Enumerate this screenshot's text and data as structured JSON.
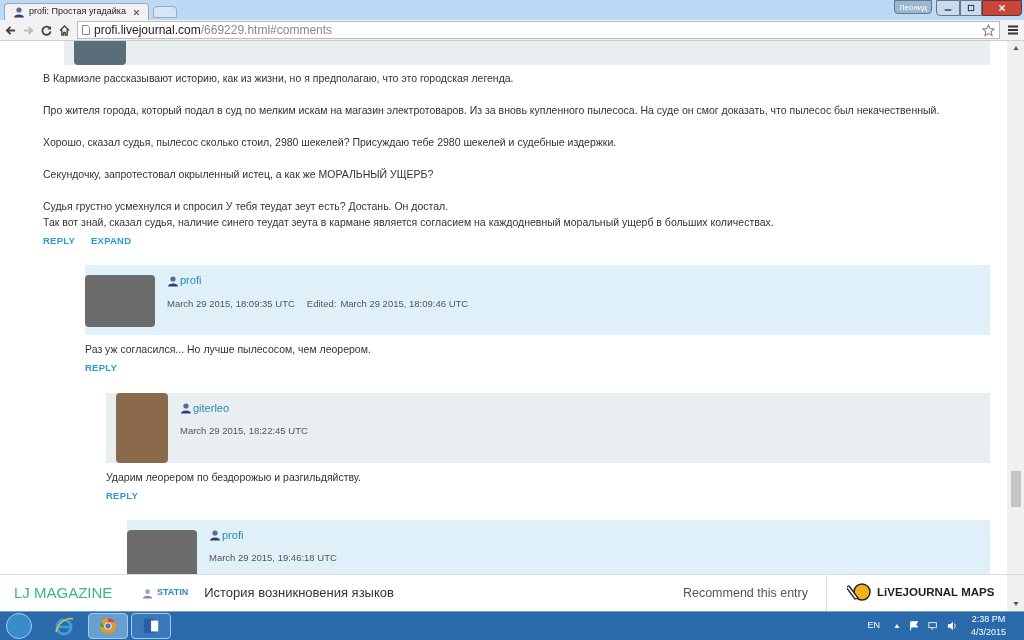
{
  "browser": {
    "tab_title": "profi: Простая угадайка",
    "user_button": "Леонид",
    "url_host": "profi.livejournal.com",
    "url_path": "/669229.html#comments"
  },
  "comments": [
    {
      "paragraphs": [
        "В Кармиэле рассказывают историю, как из жизни, но я предполагаю, что это городская легенда.",
        "Про жителя города, который подал в суд по мелким искам на магазин электротоваров. Из за вновь купленного пылесоса. На суде он смог доказать, что пылесос был некачественный.",
        "Хорошо, сказал судья, пылесос сколько стоил, 2980 шекелей? Присуждаю тебе 2980 шекелей и судебные издержки.",
        "Секундочку, запротестовал окрыленный истец, а как же МОРАЛЬНЫЙ УЩЕРБ?",
        "Судья грустно усмехнулся и спросил У тебя теудат зеут есть? Достань. Он достал.\nТак вот знай, сказал судья, наличие синего теудат зеута в кармане является согласием на каждодневный моральный ущерб в больших количествах."
      ],
      "actions": [
        "REPLY",
        "EXPAND"
      ],
      "children": [
        {
          "author": "profi",
          "date": "March 29 2015, 18:09:35 UTC",
          "edited_label": "Edited:",
          "edited_date": "March 29 2015, 18:09:46 UTC",
          "paragraphs": [
            "Раз уж согласился... Но лучше пылесосом, чем леорером."
          ],
          "actions": [
            "REPLY"
          ],
          "children": [
            {
              "author": "giterleo",
              "date": "March 29 2015, 18:22:45 UTC",
              "paragraphs": [
                "Ударим леорером по бездорожью и разгильдяйству."
              ],
              "actions": [
                "REPLY"
              ],
              "children": [
                {
                  "author": "profi",
                  "date": "March 29 2015, 19:46:18 UTC"
                }
              ]
            }
          ]
        }
      ]
    }
  ],
  "bottom_bar": {
    "section": "LJ MAGAZINE",
    "user": "STATIN",
    "headline": "История возникновения языков",
    "recommend": "Recommend this entry",
    "logo": "LiVEJOURNAL MAPS"
  },
  "taskbar": {
    "language": "EN",
    "time": "2:38 PM",
    "date": "4/3/2015"
  }
}
